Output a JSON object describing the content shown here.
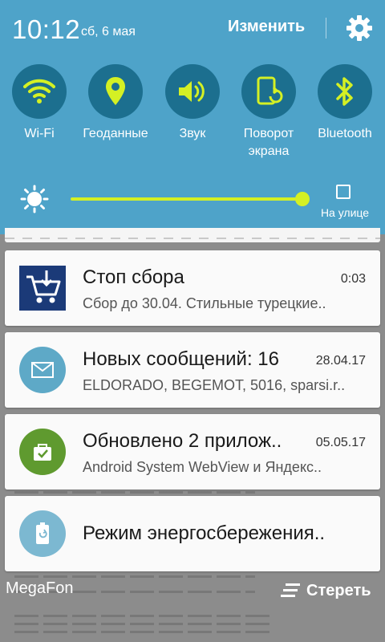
{
  "status": {
    "time": "10:12",
    "date": "сб, 6 мая",
    "edit_label": "Изменить"
  },
  "quick_settings": [
    {
      "label": "Wi-Fi",
      "icon": "wifi-icon",
      "active": true
    },
    {
      "label": "Геоданные",
      "icon": "location-icon",
      "active": true
    },
    {
      "label": "Звук",
      "icon": "sound-icon",
      "active": true
    },
    {
      "label": "Поворот экрана",
      "icon": "rotation-icon",
      "active": true
    },
    {
      "label": "Bluetooth",
      "icon": "bluetooth-icon",
      "active": true
    }
  ],
  "brightness": {
    "level_percent": 100,
    "outdoor_label": "На улице",
    "outdoor_checked": false
  },
  "notifications": [
    {
      "icon": "shopping-cart-icon",
      "title": "Стоп сбора",
      "time": "0:03",
      "text": "Сбор до 30.04. Стильные турецкие.."
    },
    {
      "icon": "email-icon",
      "title": "Новых сообщений: 16",
      "time": "28.04.17",
      "text": "ELDORADO, BEGEMOT, 5016, sparsi.r.."
    },
    {
      "icon": "app-update-icon",
      "title": "Обновлено 2 прилож..",
      "time": "05.05.17",
      "text": "Android System WebView и Яндекс.."
    },
    {
      "icon": "battery-saver-icon",
      "title": "Режим энергосбережения..",
      "time": "",
      "text": ""
    }
  ],
  "footer": {
    "carrier": "MegaFon",
    "clear_label": "Стереть"
  },
  "colors": {
    "panel_bg": "#4ea3c9",
    "tile_bg": "#1c6f8f",
    "accent": "#d4f024",
    "mail_icon_bg": "#5ea9c7",
    "update_icon_bg": "#5f9a2f",
    "battery_icon_bg": "#7cb8d1",
    "cart_icon_bg": "#1b3a78"
  }
}
